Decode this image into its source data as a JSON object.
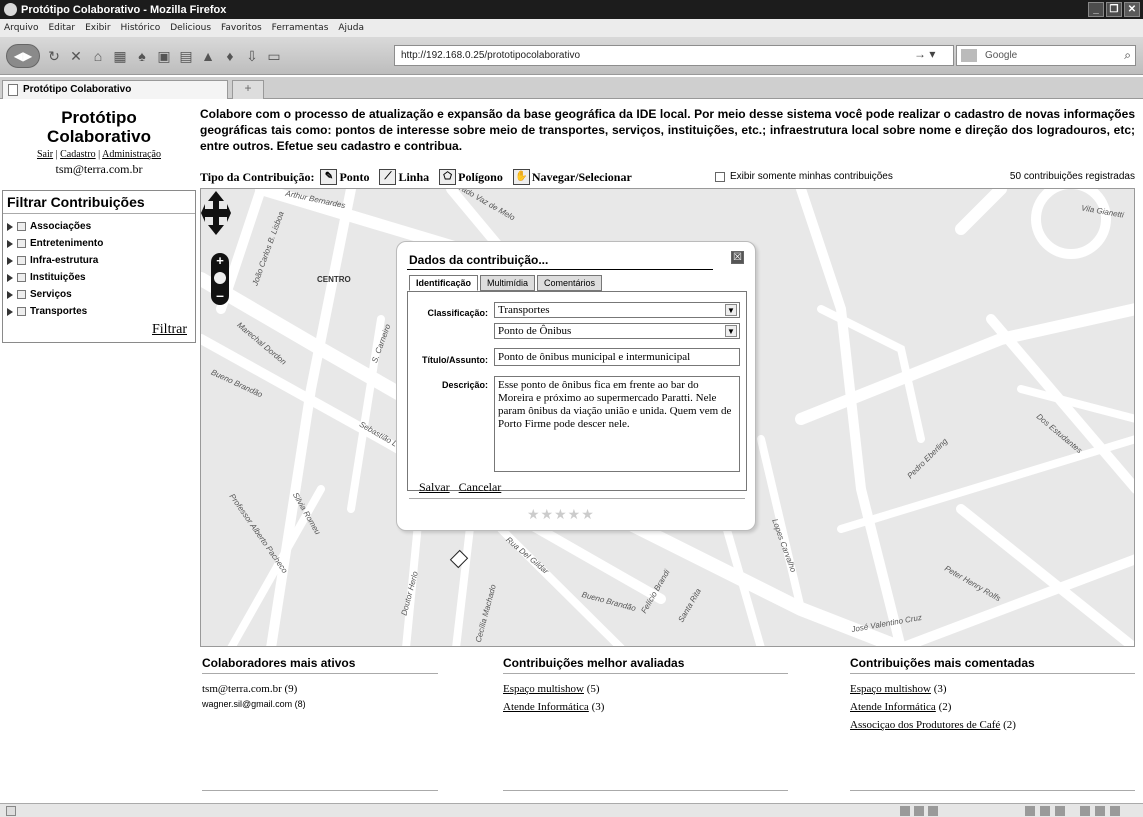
{
  "window": {
    "title": "Protótipo Colaborativo - Mozilla Firefox"
  },
  "menu": [
    "Arquivo",
    "Editar",
    "Exibir",
    "Histórico",
    "Delicious",
    "Favoritos",
    "Ferramentas",
    "Ajuda"
  ],
  "url": "http://192.168.0.25/prototipocolaborativo",
  "search_placeholder": "Google",
  "tab_title": "Protótipo Colaborativo",
  "new_tab_symbol": "+",
  "brand": {
    "title_line1": "Protótipo",
    "title_line2": "Colaborativo",
    "link_sair": "Sair",
    "link_cadastro": "Cadastro",
    "link_admin": "Administração",
    "separator": "|",
    "email": "tsm@terra.com.br"
  },
  "intro": "Colabore com o processo de atualização e expansão da base geográfica da IDE local. Por meio desse sistema você pode realizar o cadastro de novas informações geográficas tais como: pontos de interesse sobre meio de transportes, serviços, instituições, etc.; infraestrutura local sobre nome e direção dos logradouros, etc; entre outros. Efetue seu cadastro e contribua.",
  "toolbar": {
    "label": "Tipo da Contribuição:",
    "ponto": "Ponto",
    "linha": "Linha",
    "poligono": "Polígono",
    "navegar": "Navegar/Selecionar",
    "own_only": "Exibir somente minhas contribuições",
    "count": "50 contribuições registradas"
  },
  "filter": {
    "title": "Filtrar Contribuições",
    "items": [
      "Associações",
      "Entretenimento",
      "Infra-estrutura",
      "Instituições",
      "Serviços",
      "Transportes"
    ],
    "button": "Filtrar"
  },
  "map_labels": {
    "centro": "CENTRO",
    "arthur": "Arthur Bernardes",
    "carlos": "Prado Vaz de Melo",
    "lisboa": "João Carlos B. Lisboa",
    "dordon": "Marechal Dordon",
    "bueno": "Bueno Brandão",
    "sebastiao": "Sebastião Lopes",
    "alberto": "Professor Alberto Pacheco",
    "silvia": "Silvia Romeu",
    "herlo": "Doutor Herlo",
    "machado": "Cecília Machado",
    "estudantes": "Dos Estudantes",
    "bueno2": "Bueno Brandão",
    "felicio": "Felício Brandi",
    "santa": "Santa Rita",
    "gilda": "Rua Del Gildar",
    "lopes": "Lopes Carvalho",
    "henry": "Peter Henry Rolfs",
    "valentino": "José Valentino Cruz",
    "vila": "Vila Gianetti",
    "pedro": "Pedro Eberling",
    "carneiro": "S. Carneiro"
  },
  "dialog": {
    "title": "Dados da contribuição...",
    "close": "☒",
    "tabs": [
      "Identificação",
      "Multimídia",
      "Comentários"
    ],
    "label_class": "Classificação:",
    "classificacao": "Transportes",
    "subclass": "Ponto de Ônibus",
    "label_titulo": "Título/Assunto:",
    "titulo": "Ponto de ônibus municipal e intermunicipal",
    "label_desc": "Descrição:",
    "descricao": "Esse ponto de ônibus fica em frente ao bar do Moreira e próximo ao supermercado Paratti. Nele param ônibus da viação união e unida. Quem vem de Porto Firme pode descer nele.",
    "salvar": "Salvar",
    "cancelar": "Cancelar",
    "stars": "★★★★★"
  },
  "panels": {
    "ativos": {
      "title": "Colaboradores mais ativos",
      "rows": [
        "tsm@terra.com.br (9)",
        "wagner.sil@gmail.com (8)"
      ]
    },
    "avaliadas": {
      "title": "Contribuições melhor avaliadas",
      "links": [
        "Espaço multishow",
        "Atende Informática"
      ],
      "counts": [
        " (5)",
        " (3)"
      ]
    },
    "comentadas": {
      "title": "Contribuições mais comentadas",
      "links": [
        "Espaço multishow",
        "Atende Informática",
        "Associçao dos Produtores de Café"
      ],
      "counts": [
        " (3)",
        " (2)",
        " (2)"
      ]
    }
  },
  "colors": {
    "titlebar": "#1c1c1c",
    "map_bg": "#e8e8e8",
    "road": "#ffffff"
  }
}
